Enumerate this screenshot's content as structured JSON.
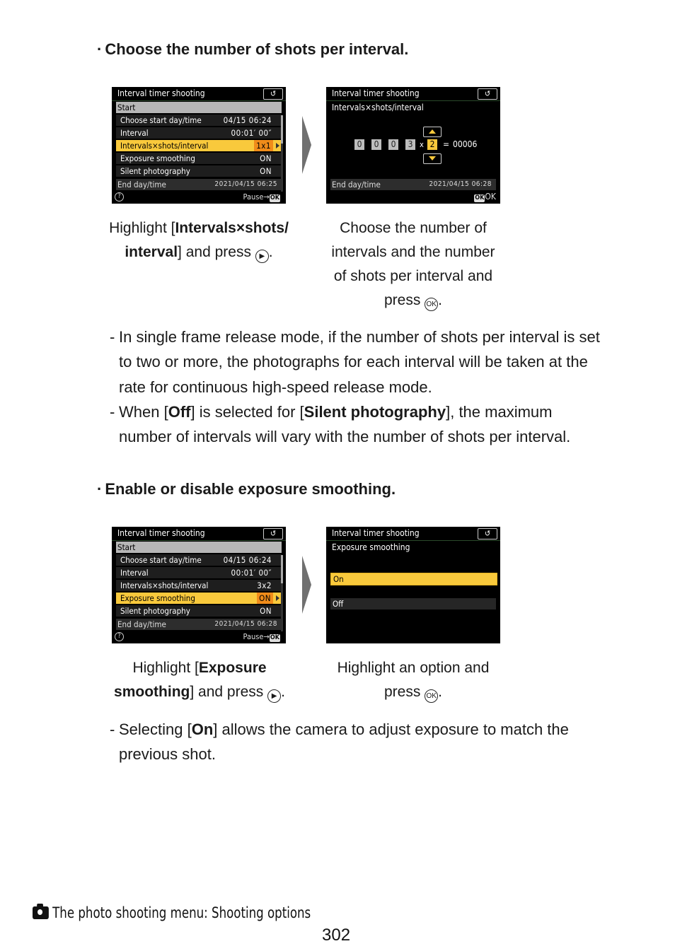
{
  "section1": {
    "heading": "Choose the number of shots per interval.",
    "screen_left": {
      "title": "Interval timer shooting",
      "back_label": "↺",
      "start_label": "Start",
      "rows": [
        {
          "label": "Choose start day/time",
          "value": "04/15  06:24"
        },
        {
          "label": "Interval",
          "value": "00:01′ 00″"
        },
        {
          "label": "Intervals×shots/interval",
          "value": "1x1"
        },
        {
          "label": "Exposure smoothing",
          "value": "ON"
        },
        {
          "label": "Silent photography",
          "value": "ON"
        }
      ],
      "highlighted_index": 2,
      "end_label": "End day/time",
      "end_value": "2021/04/15  06:25",
      "help_label": "?",
      "pause_label": "Pause→",
      "ok_label": "OK"
    },
    "screen_right": {
      "title": "Interval timer shooting",
      "back_label": "↺",
      "subtitle": "Intervals×shots/interval",
      "digits": [
        "0",
        "0",
        "0",
        "3"
      ],
      "times": "x",
      "shots": "2",
      "equals": "=",
      "total": "00006",
      "end_label": "End day/time",
      "end_value": "2021/04/15  06:28",
      "ok_badge": "OK",
      "ok_label": "OK"
    },
    "caption_left": {
      "pre": "Highlight [",
      "bold1": "Intervals×shots/",
      "bold2": "interval",
      "post": "] and press",
      "glyph": "▶",
      "end": "."
    },
    "caption_right": {
      "line1": "Choose the number of",
      "line2": "intervals and the number",
      "line3": "of shots per interval and",
      "line4": "press",
      "glyph": "OK",
      "end": "."
    },
    "notes": [
      {
        "dash": "-",
        "text": "In single frame release mode, if the number of shots per interval is set to two or more, the photographs for each interval will be taken at the rate for continuous high-speed release mode."
      },
      {
        "dash": "-",
        "pre": "When [",
        "bold1": "Off",
        "mid": "] is selected for [",
        "bold2": "Silent photography",
        "post": "], the maximum number of intervals will vary with the number of shots per interval."
      }
    ]
  },
  "section2": {
    "heading": "Enable or disable exposure smoothing.",
    "screen_left": {
      "title": "Interval timer shooting",
      "back_label": "↺",
      "start_label": "Start",
      "rows": [
        {
          "label": "Choose start day/time",
          "value": "04/15  06:24"
        },
        {
          "label": "Interval",
          "value": "00:01′ 00″"
        },
        {
          "label": "Intervals×shots/interval",
          "value": "3x2"
        },
        {
          "label": "Exposure smoothing",
          "value": "ON"
        },
        {
          "label": "Silent photography",
          "value": "ON"
        }
      ],
      "highlighted_index": 3,
      "end_label": "End day/time",
      "end_value": "2021/04/15  06:28",
      "help_label": "?",
      "pause_label": "Pause→",
      "ok_label": "OK"
    },
    "screen_right": {
      "title": "Interval timer shooting",
      "back_label": "↺",
      "subtitle": "Exposure smoothing",
      "options": [
        "On",
        "Off"
      ],
      "selected_option": "On"
    },
    "caption_left": {
      "pre": "Highlight [",
      "bold1": "Exposure",
      "bold2": "smoothing",
      "post": "] and press",
      "glyph": "▶",
      "end": "."
    },
    "caption_right": {
      "line1": "Highlight an option and",
      "line2": "press",
      "glyph": "OK",
      "end": "."
    },
    "notes": [
      {
        "dash": "-",
        "pre": "Selecting [",
        "bold1": "On",
        "post": "] allows the camera to adjust exposure to match the previous shot."
      }
    ]
  },
  "bullet_dot": "·",
  "footer": {
    "section_title": "The photo shooting menu: Shooting options",
    "page_number": "302"
  }
}
